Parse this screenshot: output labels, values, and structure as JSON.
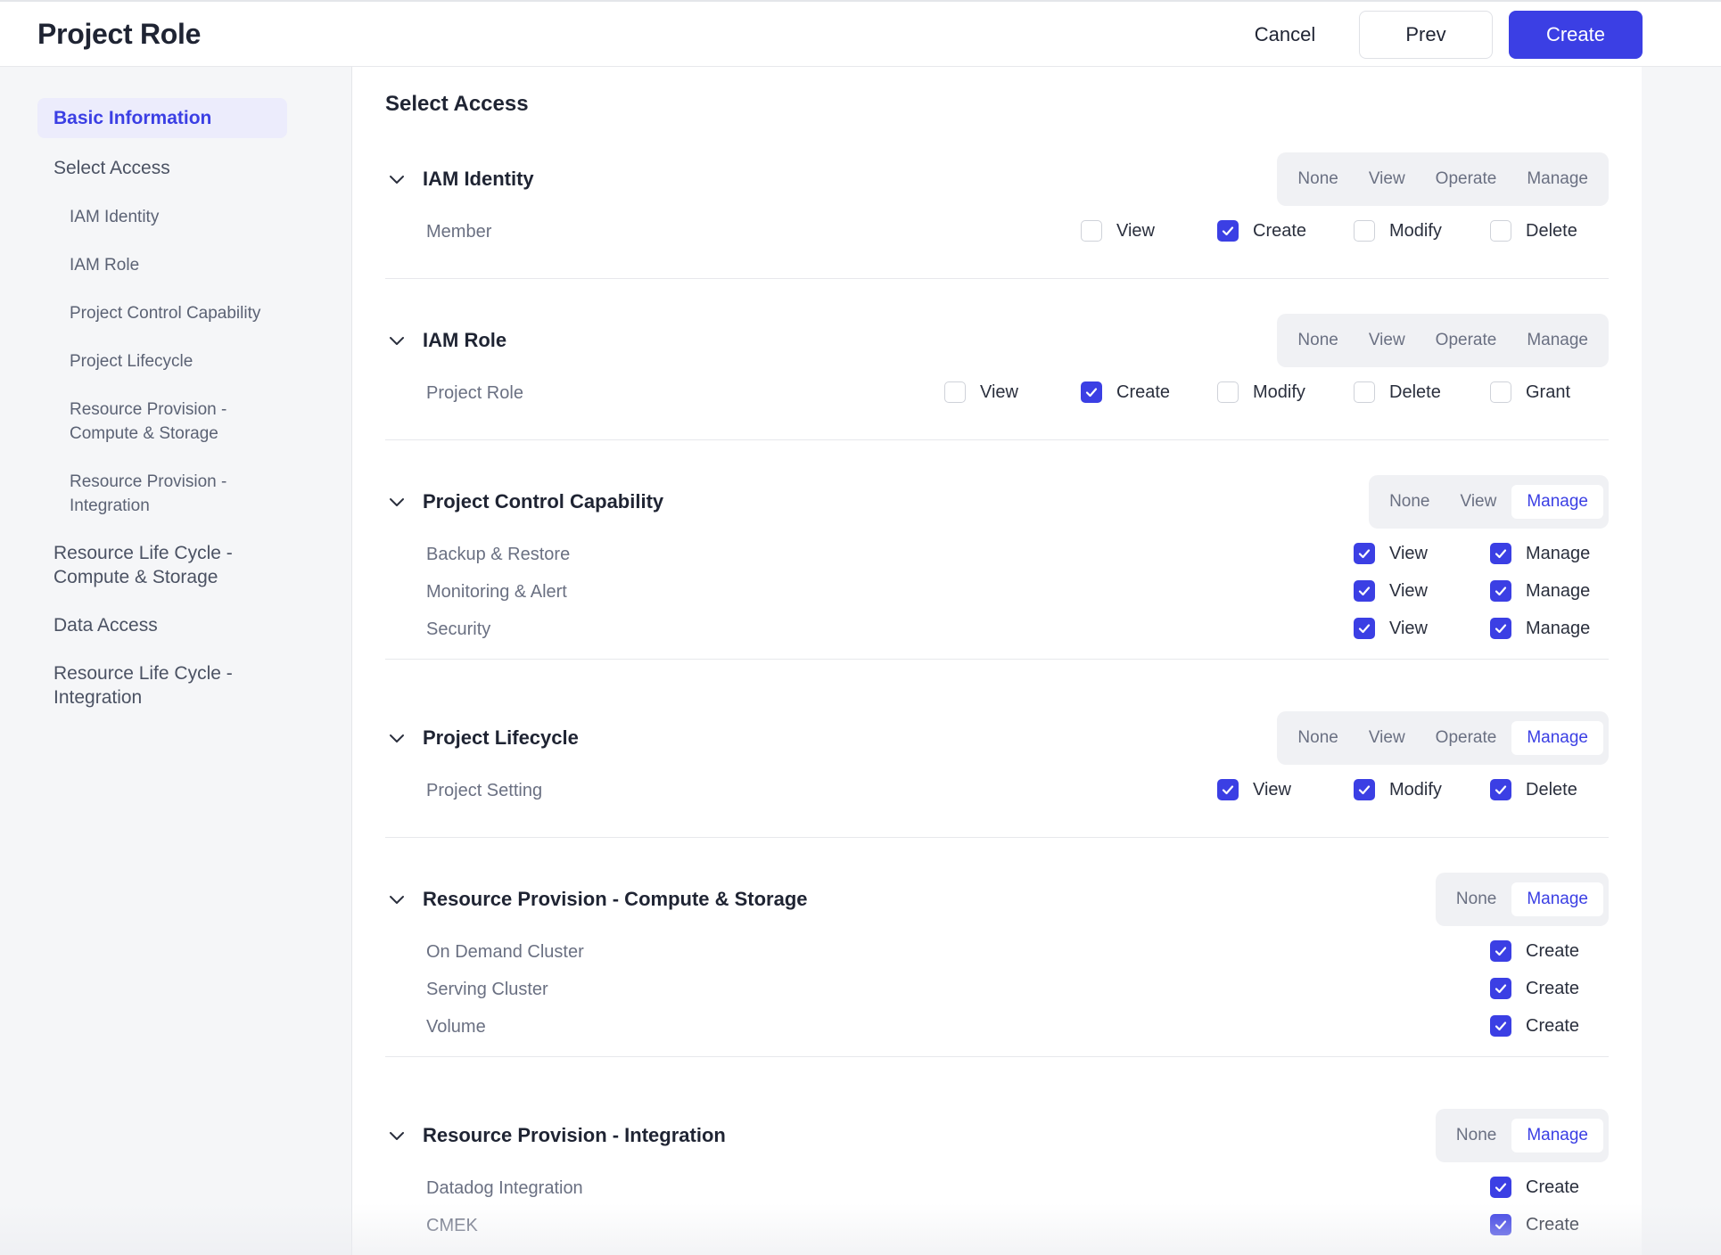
{
  "header": {
    "title": "Project Role",
    "cancel_label": "Cancel",
    "prev_label": "Prev",
    "create_label": "Create",
    "accent_color": "#3b3fe4"
  },
  "sidebar": {
    "items": [
      {
        "label": "Basic Information",
        "active": true
      },
      {
        "label": "Select Access"
      },
      {
        "label": "IAM Identity"
      },
      {
        "label": "IAM Role"
      },
      {
        "label": "Project Control Capability"
      },
      {
        "label": "Project Lifecycle"
      },
      {
        "label": "Resource Provision - Compute & Storage"
      },
      {
        "label": "Resource Provision - Integration"
      },
      {
        "label": "Resource Life Cycle - Compute & Storage"
      },
      {
        "label": "Data Access"
      },
      {
        "label": "Resource Life Cycle - Integration"
      }
    ]
  },
  "main": {
    "title": "Select Access",
    "sections": [
      {
        "title": "IAM Identity",
        "levels": [
          "None",
          "View",
          "Operate",
          "Manage"
        ],
        "selected_level": null,
        "rows": [
          {
            "label": "Member",
            "perms": [
              {
                "label": "View",
                "checked": false
              },
              {
                "label": "Create",
                "checked": true
              },
              {
                "label": "Modify",
                "checked": false
              },
              {
                "label": "Delete",
                "checked": false
              }
            ]
          }
        ]
      },
      {
        "title": "IAM Role",
        "levels": [
          "None",
          "View",
          "Operate",
          "Manage"
        ],
        "selected_level": null,
        "rows": [
          {
            "label": "Project Role",
            "perms": [
              {
                "label": "View",
                "checked": false
              },
              {
                "label": "Create",
                "checked": true
              },
              {
                "label": "Modify",
                "checked": false
              },
              {
                "label": "Delete",
                "checked": false
              },
              {
                "label": "Grant",
                "checked": false
              }
            ]
          }
        ]
      },
      {
        "title": "Project Control Capability",
        "levels": [
          "None",
          "View",
          "Manage"
        ],
        "selected_level": "Manage",
        "rows": [
          {
            "label": "Backup & Restore",
            "perms": [
              {
                "label": "View",
                "checked": true
              },
              {
                "label": "Manage",
                "checked": true
              }
            ]
          },
          {
            "label": "Monitoring & Alert",
            "perms": [
              {
                "label": "View",
                "checked": true
              },
              {
                "label": "Manage",
                "checked": true
              }
            ]
          },
          {
            "label": "Security",
            "perms": [
              {
                "label": "View",
                "checked": true
              },
              {
                "label": "Manage",
                "checked": true
              }
            ]
          }
        ]
      },
      {
        "title": "Project Lifecycle",
        "levels": [
          "None",
          "View",
          "Operate",
          "Manage"
        ],
        "selected_level": "Manage",
        "rows": [
          {
            "label": "Project Setting",
            "perms": [
              {
                "label": "View",
                "checked": true
              },
              {
                "label": "Modify",
                "checked": true
              },
              {
                "label": "Delete",
                "checked": true
              }
            ]
          }
        ]
      },
      {
        "title": "Resource Provision - Compute & Storage",
        "levels": [
          "None",
          "Manage"
        ],
        "selected_level": "Manage",
        "rows": [
          {
            "label": "On Demand Cluster",
            "perms": [
              {
                "label": "Create",
                "checked": true
              }
            ]
          },
          {
            "label": "Serving Cluster",
            "perms": [
              {
                "label": "Create",
                "checked": true
              }
            ]
          },
          {
            "label": "Volume",
            "perms": [
              {
                "label": "Create",
                "checked": true
              }
            ]
          }
        ]
      },
      {
        "title": "Resource Provision - Integration",
        "levels": [
          "None",
          "Manage"
        ],
        "selected_level": "Manage",
        "rows": [
          {
            "label": "Datadog Integration",
            "perms": [
              {
                "label": "Create",
                "checked": true
              }
            ]
          },
          {
            "label": "CMEK",
            "perms": [
              {
                "label": "Create",
                "checked": true
              }
            ]
          }
        ]
      }
    ]
  }
}
